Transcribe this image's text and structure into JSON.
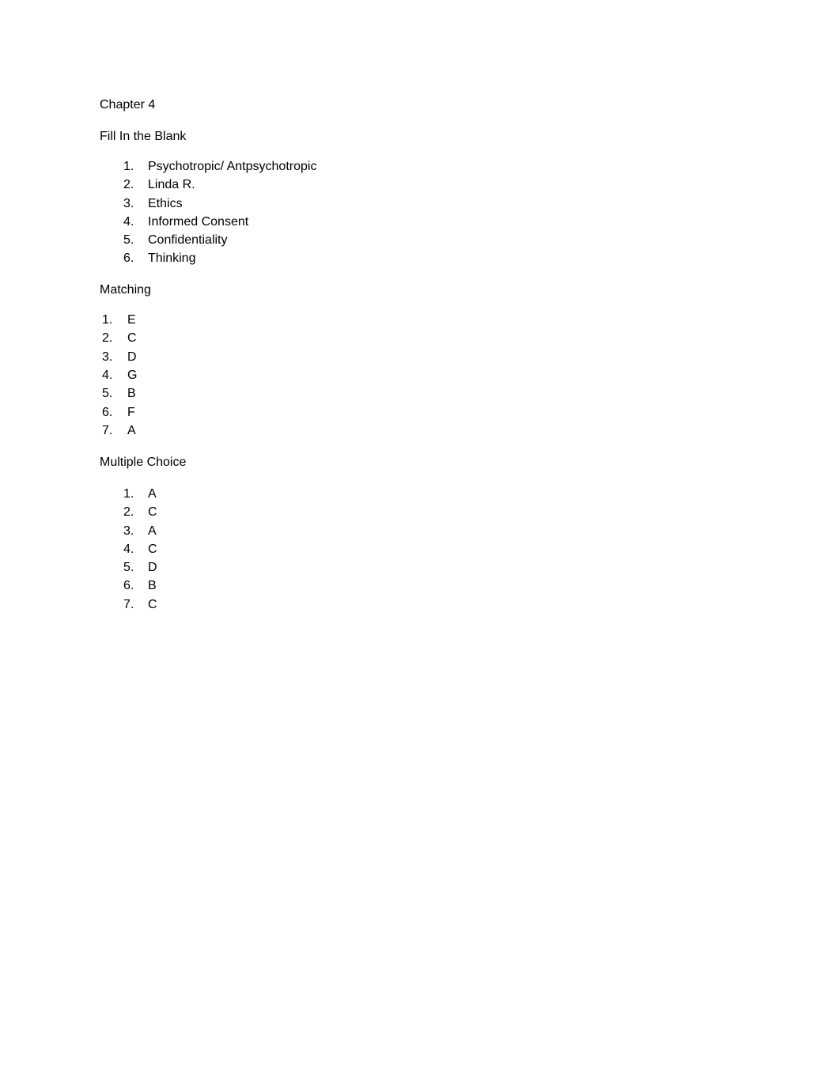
{
  "document": {
    "title": "Chapter 4",
    "sections": [
      {
        "heading": "Fill In the Blank",
        "items": [
          {
            "number": "1.",
            "answer": "Psychotropic/ Antpsychotropic"
          },
          {
            "number": "2.",
            "answer": "Linda R."
          },
          {
            "number": "3.",
            "answer": "Ethics"
          },
          {
            "number": "4.",
            "answer": "Informed Consent"
          },
          {
            "number": "5.",
            "answer": "Confidentiality"
          },
          {
            "number": "6.",
            "answer": "Thinking"
          }
        ]
      },
      {
        "heading": "Matching",
        "items": [
          {
            "number": "1.",
            "answer": "E"
          },
          {
            "number": "2.",
            "answer": "C"
          },
          {
            "number": "3.",
            "answer": "D"
          },
          {
            "number": "4.",
            "answer": "G"
          },
          {
            "number": "5.",
            "answer": "B"
          },
          {
            "number": "6.",
            "answer": "F"
          },
          {
            "number": "7.",
            "answer": "A"
          }
        ]
      },
      {
        "heading": "Multiple Choice",
        "items": [
          {
            "number": "1.",
            "answer": "A"
          },
          {
            "number": "2.",
            "answer": "C"
          },
          {
            "number": "3.",
            "answer": "A"
          },
          {
            "number": "4.",
            "answer": "C"
          },
          {
            "number": "5.",
            "answer": "D"
          },
          {
            "number": "6.",
            "answer": "B"
          },
          {
            "number": "7.",
            "answer": "C"
          }
        ]
      }
    ]
  }
}
